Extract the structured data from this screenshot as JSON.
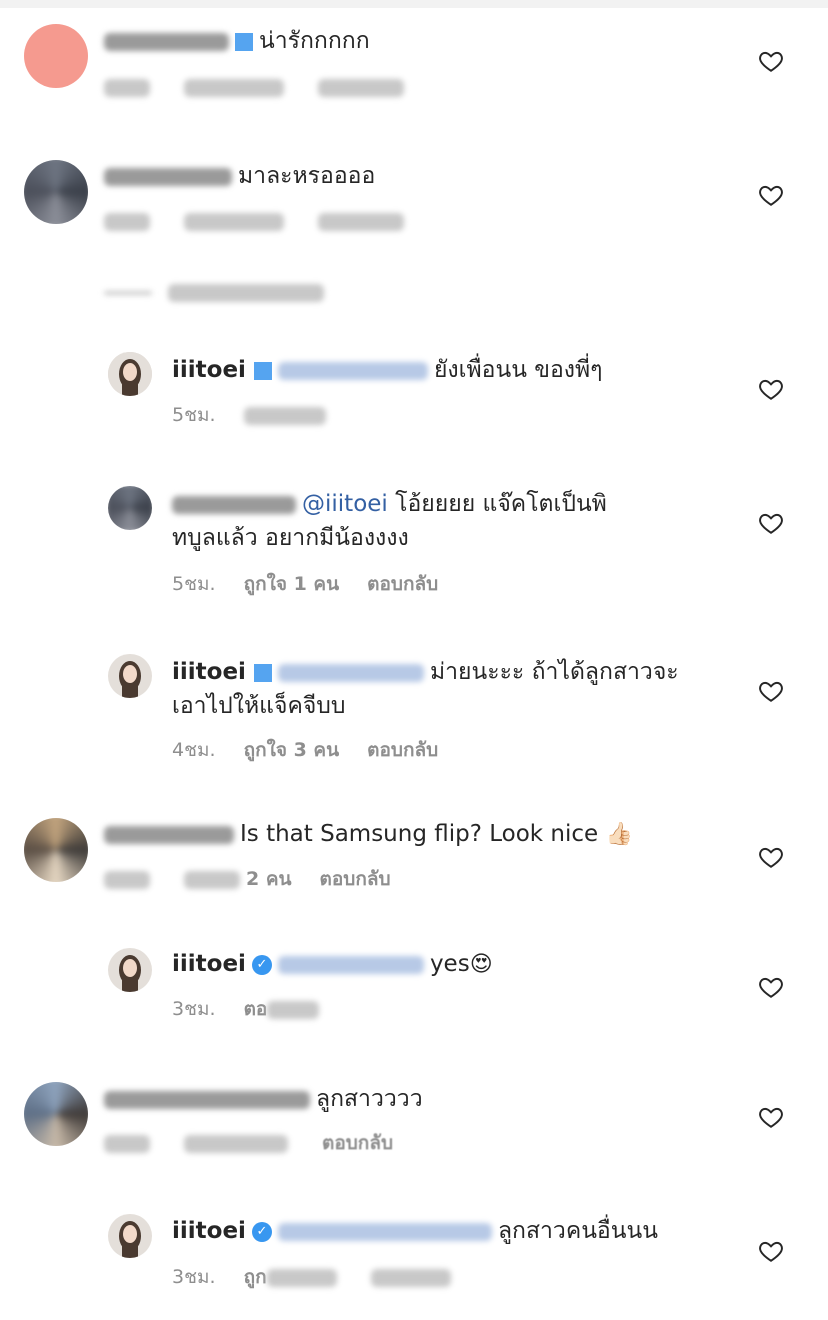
{
  "colors": {
    "text": "#262626",
    "meta": "#8e8e8e",
    "mention": "#3460a3",
    "verified": "#3897f0",
    "heart_stroke": "#262626"
  },
  "comments": [
    {
      "text": "น่ารักกกกก"
    },
    {
      "text": "มาละหรออออ"
    },
    {
      "username": "iiitoei",
      "text": "ยังเพื่อนน ของพี่ๆ",
      "time": "5ชม."
    },
    {
      "mention": "@iiitoei",
      "text_line1": "โอ้ยยยย แจ๊คโตเป็นพิ",
      "text_line2": "ทบูลแล้ว อยากมีน้องงงง",
      "time": "5ชม.",
      "likes": "ถูกใจ 1 คน",
      "reply": "ตอบกลับ"
    },
    {
      "username": "iiitoei",
      "text_line1": "ม่ายนะะะ ถ้าได้ลูกสาวจะ",
      "text_line2": "เอาไปให้แจ็คจีบบ",
      "time": "4ชม.",
      "likes": "ถูกใจ 3 คน",
      "reply": "ตอบกลับ"
    },
    {
      "text": "Is that Samsung flip? Look nice",
      "emoji": "👍🏻",
      "likes": "2 คน",
      "reply": "ตอบกลับ"
    },
    {
      "username": "iiitoei",
      "text": "yes",
      "emoji": "😍",
      "time": "3ชม.",
      "reply_partial": "ตอ"
    },
    {
      "text": "ลูกสาวววว",
      "reply": "ตอบกลับ"
    },
    {
      "username": "iiitoei",
      "text": "ลูกสาวคนอื่นนน",
      "time": "3ชม.",
      "reply_partial": "ถูก"
    }
  ],
  "icons": {
    "heart": "heart-icon",
    "verified": "verified-badge-icon"
  }
}
